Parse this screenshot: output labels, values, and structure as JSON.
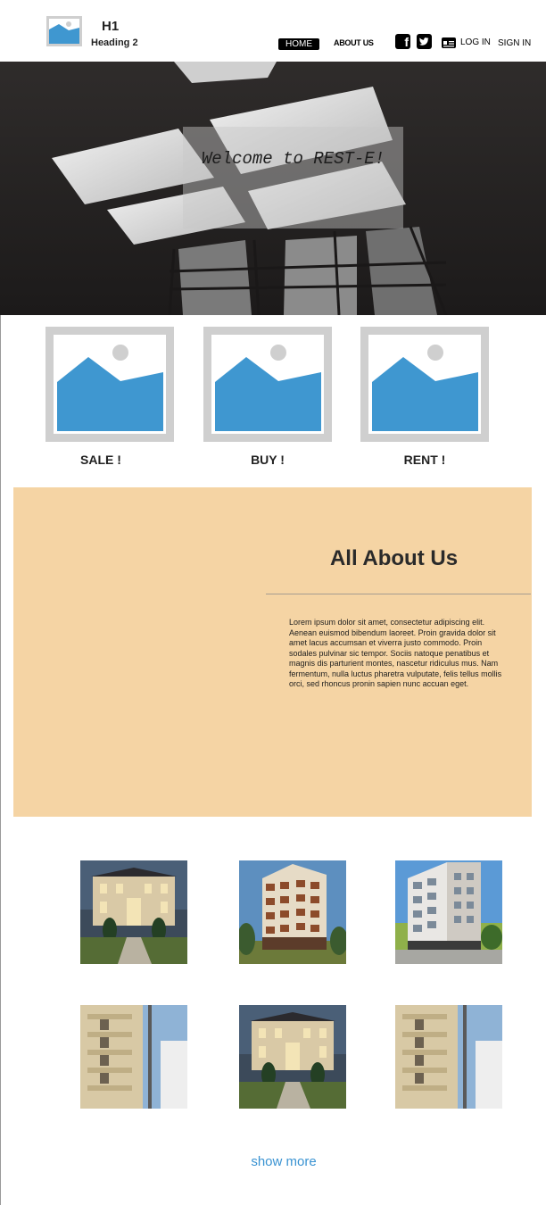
{
  "header": {
    "logo_icon": "image-placeholder-icon",
    "heading1": "H1",
    "heading2": "Heading 2",
    "nav": {
      "home_label": "HOME",
      "about_label": "ABOUT US"
    },
    "social_icons": [
      "facebook-icon",
      "twitter-icon"
    ],
    "login_icon": "id-card-icon",
    "login_label": "LOG IN",
    "signin_label": "SIGN IN"
  },
  "hero": {
    "welcome_text": "Welcome to REST-E!"
  },
  "categories": [
    {
      "label": "SALE !",
      "icon": "image-placeholder-icon"
    },
    {
      "label": "BUY !",
      "icon": "image-placeholder-icon"
    },
    {
      "label": "RENT !",
      "icon": "image-placeholder-icon"
    }
  ],
  "about": {
    "title": "All  About Us",
    "body": "Lorem ipsum dolor sit amet, consectetur adipiscing elit. Aenean euismod bibendum laoreet. Proin gravida dolor sit amet lacus accumsan et viverra justo commodo. Proin sodales pulvinar sic tempor. Sociis natoque penatibus et magnis dis parturient montes, nascetur ridiculus mus. Nam fermentum, nulla luctus pharetra vulputate, felis tellus mollis orci, sed rhoncus pronin sapien nunc accuan eget."
  },
  "gallery": [
    "villa-photo",
    "tower-photo",
    "apartment-photo",
    "building-photo",
    "villa-photo",
    "building-photo"
  ],
  "show_more_label": "show more",
  "colors": {
    "accent_blue": "#3a93d2",
    "about_background": "#f5d4a4",
    "placeholder_blue": "#3f97d0",
    "placeholder_border": "#cfcfcf"
  }
}
